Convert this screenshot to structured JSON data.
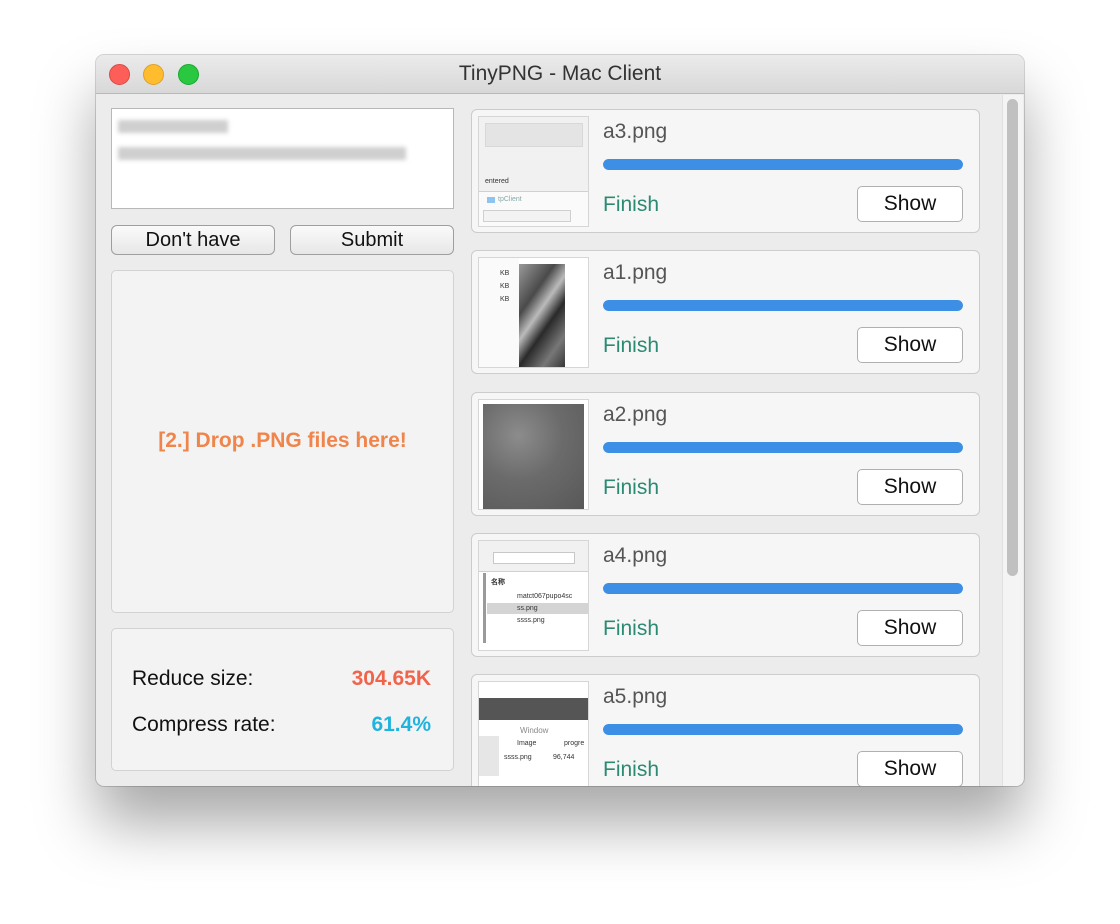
{
  "window": {
    "title": "TinyPNG - Mac Client"
  },
  "buttons": {
    "dont_have": "Don't have",
    "submit": "Submit"
  },
  "drop_zone": {
    "text": "[2.] Drop .PNG files here!"
  },
  "stats": {
    "reduce_label": "Reduce size:",
    "reduce_value": "304.65K",
    "reduce_color": "#f0644b",
    "rate_label": "Compress rate:",
    "rate_value": "61.4%",
    "rate_color": "#1fb3dd"
  },
  "files": [
    {
      "name": "a3.png",
      "status": "Finish",
      "show": "Show",
      "progress": 1.0
    },
    {
      "name": "a1.png",
      "status": "Finish",
      "show": "Show",
      "progress": 1.0
    },
    {
      "name": "a2.png",
      "status": "Finish",
      "show": "Show",
      "progress": 1.0
    },
    {
      "name": "a4.png",
      "status": "Finish",
      "show": "Show",
      "progress": 1.0
    },
    {
      "name": "a5.png",
      "status": "Finish",
      "show": "Show",
      "progress": 1.0
    }
  ],
  "thumbs": {
    "a3": {
      "word": "entered",
      "folder": "tpClient"
    },
    "a1": {
      "kb": "KB"
    },
    "a4": {
      "col": "名称",
      "f1": "matct067pupo4sc",
      "f2": "ss.png",
      "f3": "ssss.png"
    },
    "a5": {
      "window": "Window",
      "image": "Image",
      "progress": "progre",
      "file": "ssss.png",
      "size": "96,744"
    }
  }
}
